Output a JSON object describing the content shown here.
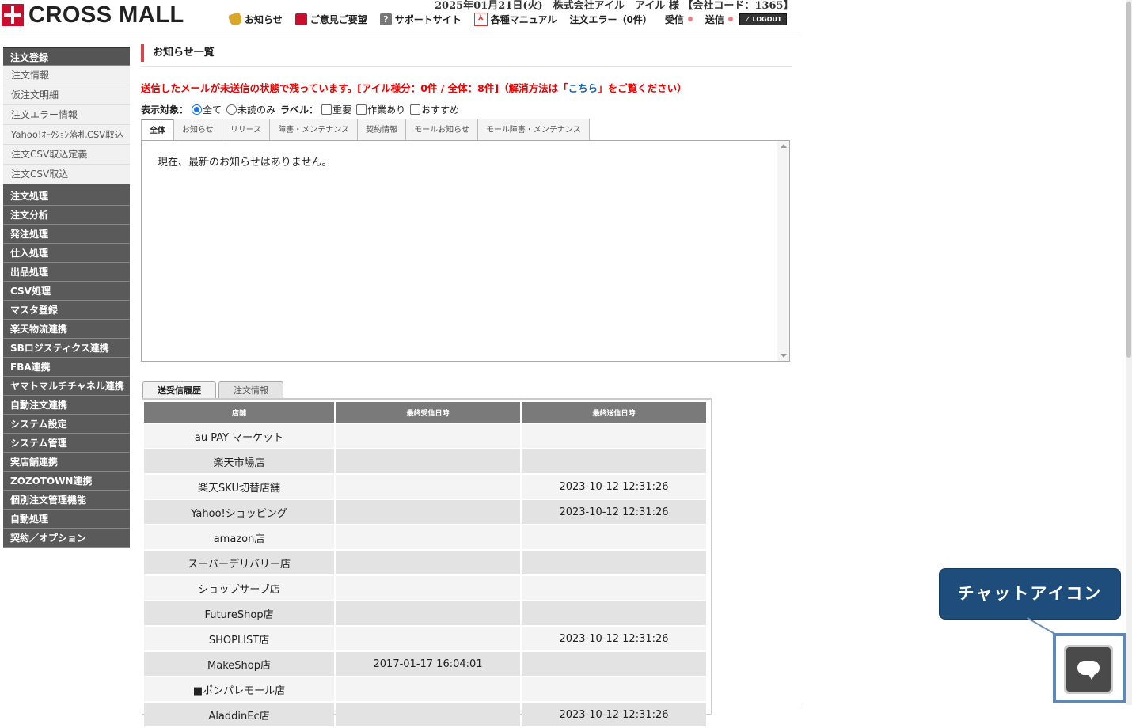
{
  "header": {
    "logo_text": "CROSS MALL",
    "company_line": "2025年01月21日(火)　株式会社アイル　アイル 様 【会社コード：1365】",
    "nav": {
      "notice": "お知らせ",
      "feedback": "ご意見ご要望",
      "support": "サポートサイト",
      "manual": "各種マニュアル",
      "order_error": "注文エラー（0件）",
      "receive": "受信",
      "send": "送信",
      "logout": "LOGOUT"
    }
  },
  "sidebar": {
    "order_register": {
      "label": "注文登録",
      "items": [
        "注文情報",
        "仮注文明細",
        "注文エラー情報",
        "Yahoo!ｵｰｸｼｮﾝ落札CSV取込",
        "注文CSV取込定義",
        "注文CSV取込"
      ]
    },
    "menus": [
      "注文処理",
      "注文分析",
      "発注処理",
      "仕入処理",
      "出品処理",
      "CSV処理",
      "マスタ登録",
      "楽天物流連携",
      "SBロジスティクス連携",
      "FBA連携",
      "ヤマトマルチチャネル連携",
      "自動注文連携",
      "システム設定",
      "システム管理",
      "実店舗連携",
      "ZOZOTOWN連携",
      "個別注文管理機能",
      "自動処理",
      "契約／オプション"
    ]
  },
  "main": {
    "title": "お知らせ一覧",
    "alert_pre": "送信したメールが未送信の状態で残っています。[アイル様分：0件 / 全体：8件]（解消方法は「",
    "alert_link": "こちら",
    "alert_post": "」をご覧ください）",
    "filter": {
      "target_label": "表示対象：",
      "all": "全て",
      "unread": "未読のみ",
      "label_label": "ラベル：",
      "important": "重要",
      "action": "作業あり",
      "recommended": "おすすめ"
    },
    "tabs": [
      "全体",
      "お知らせ",
      "リリース",
      "障害・メンテナンス",
      "契約情報",
      "モールお知らせ",
      "モール障害・メンテナンス"
    ],
    "no_notice": "現在、最新のお知らせはありません。",
    "sub_tabs": [
      "送受信履歴",
      "注文情報"
    ],
    "shop_table": {
      "headers": [
        "店舗",
        "最終受信日時",
        "最終送信日時"
      ],
      "rows": [
        [
          "au PAY マーケット",
          "",
          ""
        ],
        [
          "楽天市場店",
          "",
          ""
        ],
        [
          "楽天SKU切替店舗",
          "",
          "2023-10-12 12:31:26"
        ],
        [
          "Yahoo!ショッピング",
          "",
          "2023-10-12 12:31:26"
        ],
        [
          "amazon店",
          "",
          ""
        ],
        [
          "スーパーデリバリー店",
          "",
          ""
        ],
        [
          "ショップサーブ店",
          "",
          ""
        ],
        [
          "FutureShop店",
          "",
          ""
        ],
        [
          "SHOPLIST店",
          "",
          "2023-10-12 12:31:26"
        ],
        [
          "MakeShop店",
          "2017-01-17 16:04:01",
          ""
        ],
        [
          "■ポンパレモール店",
          "",
          ""
        ],
        [
          "AladdinEc店",
          "",
          "2023-10-12 12:31:26"
        ]
      ]
    }
  },
  "chat": {
    "callout": "チャットアイコン"
  }
}
